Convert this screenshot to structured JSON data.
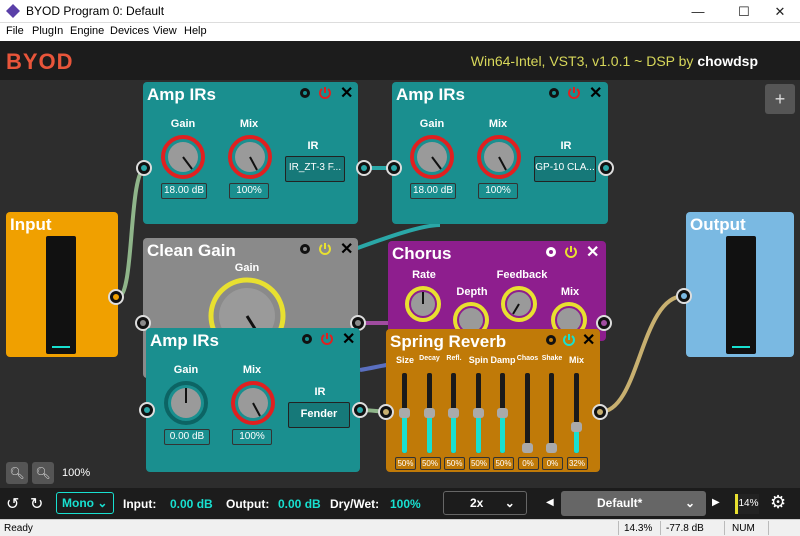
{
  "window": {
    "title": "BYOD Program 0: Default",
    "minimize": "—",
    "maximize": "☐",
    "close": "✕"
  },
  "menu": [
    {
      "label": "File"
    },
    {
      "label": "PlugIn"
    },
    {
      "label": "Engine"
    },
    {
      "label": "Devices"
    },
    {
      "label": "View"
    },
    {
      "label": "Help"
    }
  ],
  "header": {
    "logo": "BYOD",
    "version_prefix": "Win64-Intel, VST3, v1.0.1 ~ DSP by",
    "author": "chowdsp"
  },
  "board": {
    "add_button": "+",
    "zoom_level": "100%",
    "input_module": {
      "title": "Input"
    },
    "output_module": {
      "title": "Output"
    },
    "amp_irs_1": {
      "title": "Amp IRs",
      "gain_label": "Gain",
      "gain_value": "18.00 dB",
      "mix_label": "Mix",
      "mix_value": "100%",
      "ir_label": "IR",
      "ir_value": "IR_ZT-3 F..."
    },
    "amp_irs_2": {
      "title": "Amp IRs",
      "gain_label": "Gain",
      "gain_value": "18.00 dB",
      "mix_label": "Mix",
      "mix_value": "100%",
      "ir_label": "IR",
      "ir_value": "GP-10 CLA..."
    },
    "amp_irs_3": {
      "title": "Amp IRs",
      "gain_label": "Gain",
      "gain_value": "0.00 dB",
      "mix_label": "Mix",
      "mix_value": "100%",
      "ir_label": "IR",
      "ir_value": "Fender"
    },
    "clean_gain": {
      "title": "Clean Gain",
      "gain_label": "Gain"
    },
    "chorus": {
      "title": "Chorus",
      "rate_label": "Rate",
      "depth_label": "Depth",
      "feedback_label": "Feedback",
      "mix_label": "Mix"
    },
    "spring_reverb": {
      "title": "Spring Reverb",
      "sliders": [
        {
          "label": "Size",
          "value": "50%",
          "level": 0.5
        },
        {
          "label": "Decay",
          "value": "50%",
          "level": 0.5
        },
        {
          "label": "Refl.",
          "value": "50%",
          "level": 0.5
        },
        {
          "label": "Spin",
          "value": "50%",
          "level": 0.5
        },
        {
          "label": "Damp",
          "value": "50%",
          "level": 0.5
        },
        {
          "label": "Chaos",
          "value": "0%",
          "level": 0.0
        },
        {
          "label": "Shake",
          "value": "0%",
          "level": 0.0
        },
        {
          "label": "Mix",
          "value": "32%",
          "level": 0.32
        }
      ]
    }
  },
  "footer": {
    "mono_label": "Mono",
    "input_label": "Input:",
    "input_value": "0.00 dB",
    "output_label": "Output:",
    "output_value": "0.00 dB",
    "drywet_label": "Dry/Wet:",
    "drywet_value": "100%",
    "oversampling": "2x",
    "preset": "Default*",
    "cpu": "14%"
  },
  "status": {
    "ready": "Ready",
    "cpu": "14.3%",
    "db": "-77.8 dB",
    "num": "NUM"
  },
  "colors": {
    "teal": "#1a8f8f",
    "gray": "#8a8a8a",
    "purple": "#8e1e8e",
    "orange": "#c07a08",
    "input": "#f0a000",
    "output": "#7ab9e2",
    "accent": "#18e0d0",
    "knob_ring": "#e02020"
  }
}
